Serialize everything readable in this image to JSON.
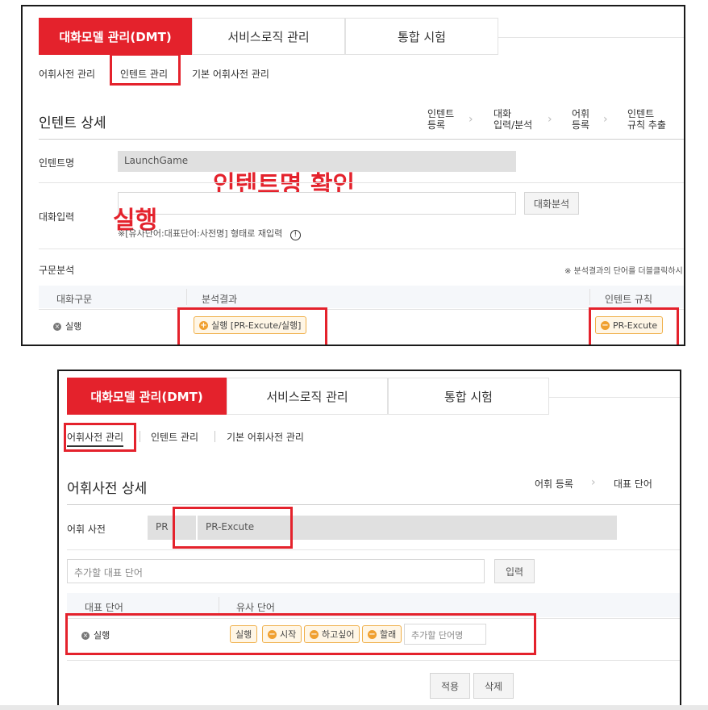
{
  "colors": {
    "accent": "#e4222c",
    "chip_border": "#f0b04a",
    "chip_bg": "#fff6e6"
  },
  "tabs": [
    "대화모델 관리(DMT)",
    "서비스로직 관리",
    "통합 시험"
  ],
  "top": {
    "subnav": [
      "어휘사전 관리",
      "인텐트 관리",
      "기본 어휘사전 관리"
    ],
    "title": "인텐트 상세",
    "steps": [
      {
        "line1": "인텐트",
        "line2": "등록"
      },
      {
        "line1": "대화",
        "line2": "입력/분석"
      },
      {
        "line1": "어휘",
        "line2": "등록"
      },
      {
        "line1": "인텐트",
        "line2": "규칙 추출"
      }
    ],
    "intent_name_label": "인텐트명",
    "intent_name_value": "LaunchGame",
    "annotation_confirm": "인텐트명 확인",
    "dialog_input_label": "대화입력",
    "annotation_exec": "실행",
    "analyze_button": "대화분석",
    "hint": "※[유사단어:대표단어:사전명] 형태로 재입력",
    "hint_icon": "info-icon",
    "parse_label": "구문분석",
    "parse_hint": "※ 분석결과의 단어를 더블클릭하시",
    "table_headers": [
      "대화구문",
      "분석결과",
      "인텐트 규칙"
    ],
    "row": {
      "phrase": "실행",
      "result_chip": "실행 [PR-Excute/실행]",
      "rule_chip": "PR-Excute"
    }
  },
  "bottom": {
    "subnav": [
      "어휘사전 관리",
      "인텐트 관리",
      "기본 어휘사전 관리"
    ],
    "title": "어휘사전 상세",
    "steps": [
      "어휘 등록",
      "대표 단어"
    ],
    "dict_label": "어휘 사전",
    "dict_prefix": "PR",
    "dict_value": "PR-Excute",
    "add_placeholder": "추가할 대표 단어",
    "input_button": "입력",
    "table_headers": [
      "대표 단어",
      "유사 단어"
    ],
    "row": {
      "word": "실행",
      "chips": [
        "실행",
        "시작",
        "하고싶어",
        "할래"
      ],
      "add_placeholder": "추가할 단어명"
    },
    "apply_button": "적용",
    "delete_button": "삭제"
  }
}
